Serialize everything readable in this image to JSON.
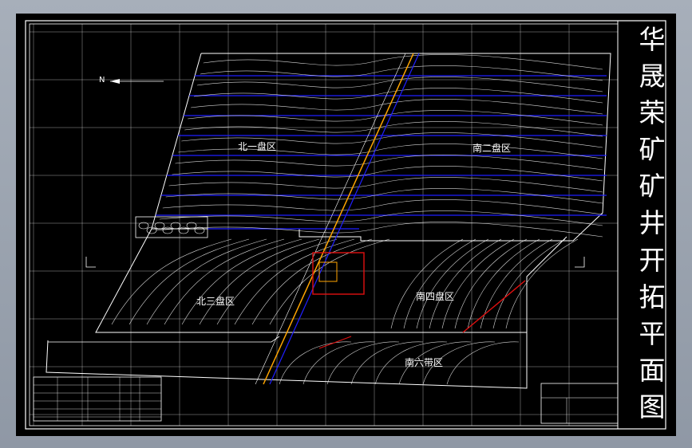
{
  "drawing": {
    "title_chars": [
      "华",
      "晟",
      "荣",
      "矿",
      "矿",
      "井",
      "开",
      "拓",
      "平",
      "面",
      "图"
    ],
    "north_label": "N",
    "zones": [
      {
        "id": "north-1",
        "label": "北一盘区"
      },
      {
        "id": "south-2",
        "label": "南二盘区"
      },
      {
        "id": "north-3",
        "label": "北三盘区"
      },
      {
        "id": "south-4",
        "label": "南四盘区"
      },
      {
        "id": "south-6",
        "label": "南六带区"
      }
    ]
  },
  "colors": {
    "background": "#000000",
    "grid": "#ffffff",
    "roadway": "#1f1fff",
    "main_shaft": "#ffa500",
    "shaft_box": "#e01010"
  }
}
